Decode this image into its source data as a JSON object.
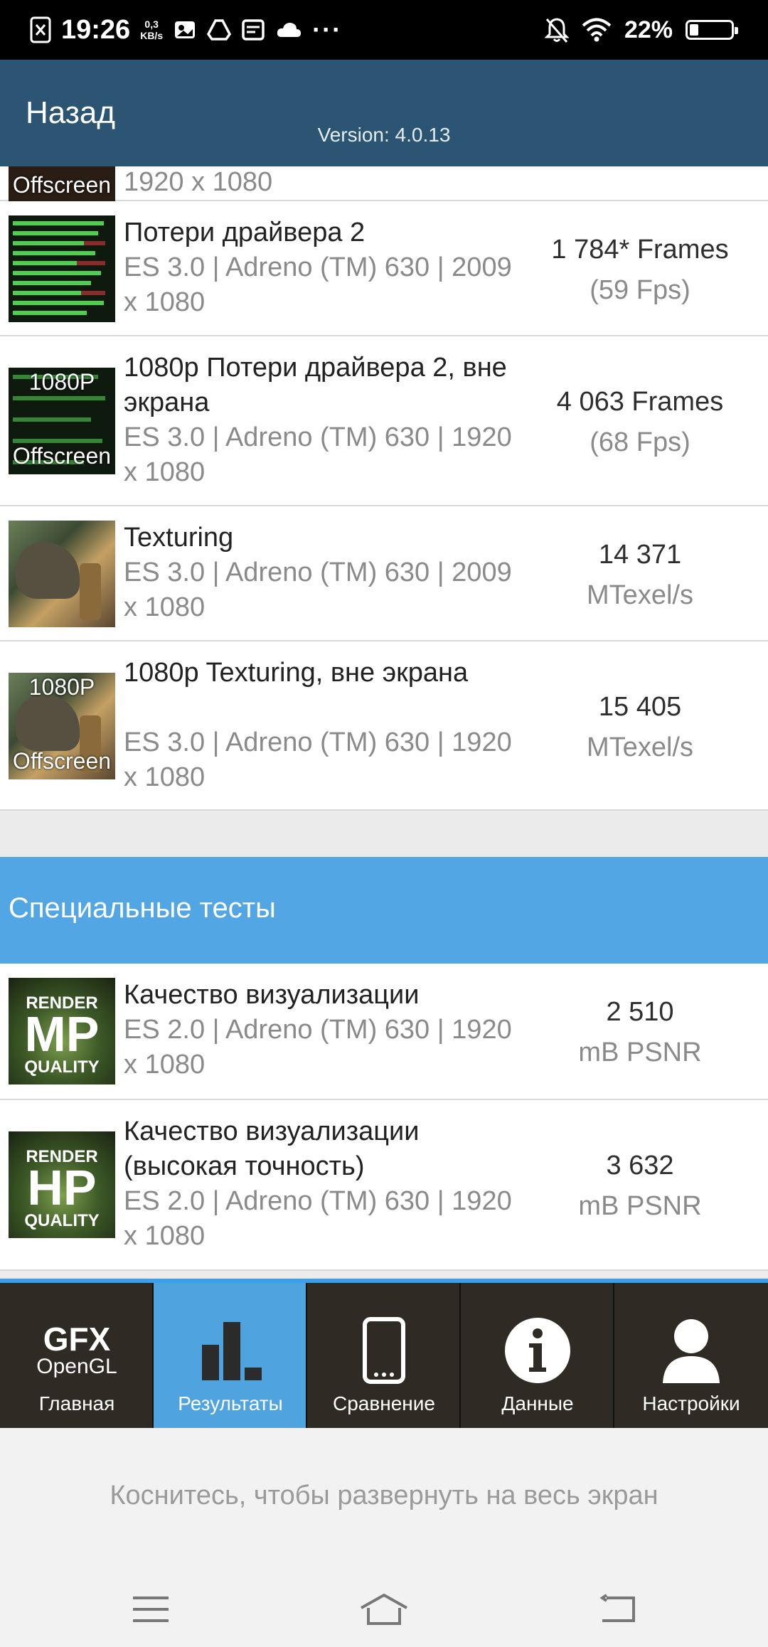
{
  "status_bar": {
    "time": "19:26",
    "speed_value": "0,3",
    "speed_unit": "KB/s",
    "more": "···",
    "battery": "22%",
    "battery_level": 0.22
  },
  "header": {
    "back_label": "Назад",
    "version": "Version: 4.0.13"
  },
  "partial_row": {
    "thumb_text": "Offscreen",
    "subtitle": "1920 x 1080"
  },
  "rows": [
    {
      "thumb": "bars",
      "title": "Потери драйвера 2",
      "subtitle": "ES 3.0 | Adreno (TM) 630 | 2009 x 1080",
      "score": "1 784* Frames",
      "score_sub": "(59 Fps)"
    },
    {
      "thumb": "bars-1080p",
      "thumb_top": "1080P",
      "thumb_bottom": "Offscreen",
      "title": "1080p Потери драйвера 2, вне экрана",
      "subtitle": "ES 3.0 | Adreno (TM) 630 | 1920 x 1080",
      "score": "4 063 Frames",
      "score_sub": "(68 Fps)"
    },
    {
      "thumb": "dino",
      "title": "Texturing",
      "subtitle": "ES 3.0 | Adreno (TM) 630 | 2009 x 1080",
      "score": "14 371",
      "score_sub": "MTexel/s"
    },
    {
      "thumb": "dino-1080p",
      "thumb_top": "1080P",
      "thumb_bottom": "Offscreen",
      "title": "1080p Texturing, вне экрана",
      "subtitle": "ES 3.0 | Adreno (TM) 630 | 1920 x 1080",
      "score": "15 405",
      "score_sub": "MTexel/s"
    }
  ],
  "special_section": {
    "title": "Специальные тесты"
  },
  "special_rows": [
    {
      "thumb_top": "RENDER",
      "thumb_mid": "MP",
      "thumb_bottom": "QUALITY",
      "title": "Качество визуализации",
      "subtitle": "ES 2.0 | Adreno (TM) 630 | 1920 x 1080",
      "score": "2 510",
      "score_sub": "mB PSNR"
    },
    {
      "thumb_top": "RENDER",
      "thumb_mid": "HP",
      "thumb_bottom": "QUALITY",
      "title": "Качество визуализации (высокая точность)",
      "subtitle": "ES 2.0 | Adreno (TM) 630 | 1920 x 1080",
      "score": "3 632",
      "score_sub": "mB PSNR"
    }
  ],
  "tabs": [
    {
      "label": "Главная",
      "icon": "gfx-opengl-icon",
      "logo_top": "GFX",
      "logo_bottom": "OpenGL"
    },
    {
      "label": "Результаты",
      "icon": "bar-chart-icon",
      "active": true
    },
    {
      "label": "Сравнение",
      "icon": "phone-icon"
    },
    {
      "label": "Данные",
      "icon": "info-icon"
    },
    {
      "label": "Настройки",
      "icon": "person-icon"
    }
  ],
  "hint": "Коснитесь, чтобы развернуть на весь экран",
  "colors": {
    "header": "#2b5572",
    "section": "#52a6e3",
    "tab_active": "#4fa3df",
    "tab_bar": "#2f2a24"
  }
}
